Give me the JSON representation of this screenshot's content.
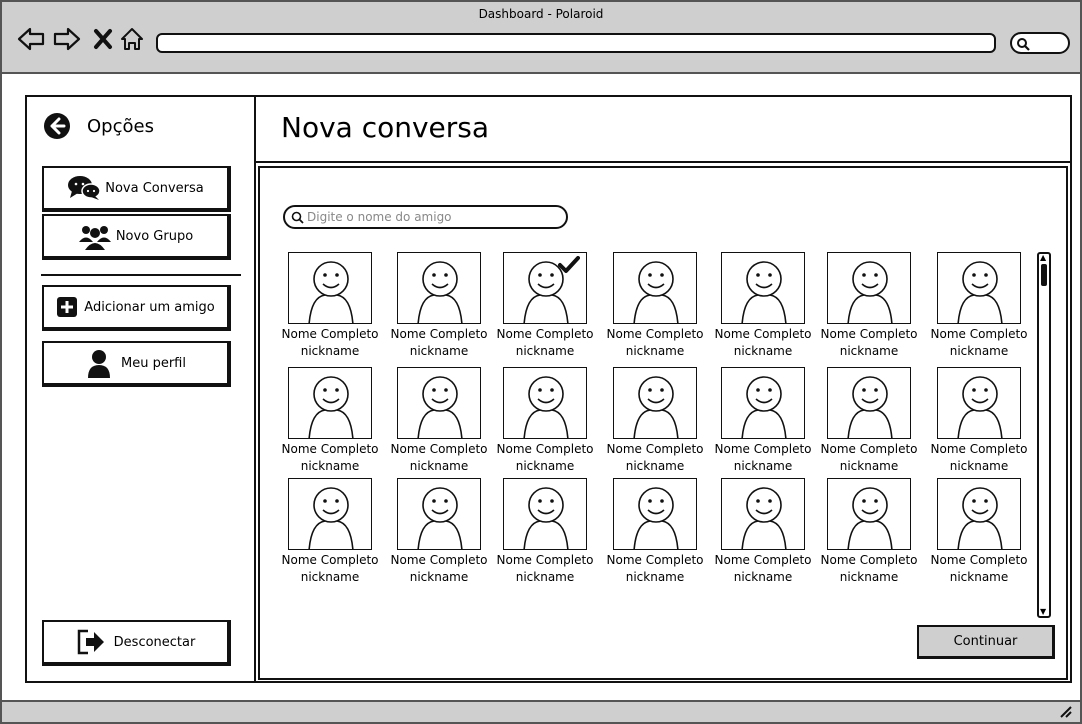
{
  "window": {
    "title": "Dashboard - Polaroid"
  },
  "sidebar": {
    "header": "Opções",
    "items": [
      {
        "label": "Nova Conversa",
        "icon": "chat-bubbles-icon"
      },
      {
        "label": "Novo Grupo",
        "icon": "group-icon"
      },
      {
        "label": "Adicionar um amigo",
        "icon": "plus-square-icon"
      },
      {
        "label": "Meu perfil",
        "icon": "user-icon"
      }
    ],
    "logout_label": "Desconectar"
  },
  "main": {
    "title": "Nova conversa",
    "search_placeholder": "Digite o nome do amigo",
    "friends": [
      {
        "name": "Nome Completo",
        "nickname": "nickname",
        "selected": false
      },
      {
        "name": "Nome Completo",
        "nickname": "nickname",
        "selected": false
      },
      {
        "name": "Nome Completo",
        "nickname": "nickname",
        "selected": true
      },
      {
        "name": "Nome Completo",
        "nickname": "nickname",
        "selected": false
      },
      {
        "name": "Nome Completo",
        "nickname": "nickname",
        "selected": false
      },
      {
        "name": "Nome Completo",
        "nickname": "nickname",
        "selected": false
      },
      {
        "name": "Nome Completo",
        "nickname": "nickname",
        "selected": false
      },
      {
        "name": "Nome Completo",
        "nickname": "nickname",
        "selected": false
      },
      {
        "name": "Nome Completo",
        "nickname": "nickname",
        "selected": false
      },
      {
        "name": "Nome Completo",
        "nickname": "nickname",
        "selected": false
      },
      {
        "name": "Nome Completo",
        "nickname": "nickname",
        "selected": false
      },
      {
        "name": "Nome Completo",
        "nickname": "nickname",
        "selected": false
      },
      {
        "name": "Nome Completo",
        "nickname": "nickname",
        "selected": false
      },
      {
        "name": "Nome Completo",
        "nickname": "nickname",
        "selected": false
      },
      {
        "name": "Nome Completo",
        "nickname": "nickname",
        "selected": false
      },
      {
        "name": "Nome Completo",
        "nickname": "nickname",
        "selected": false
      },
      {
        "name": "Nome Completo",
        "nickname": "nickname",
        "selected": false
      },
      {
        "name": "Nome Completo",
        "nickname": "nickname",
        "selected": false
      },
      {
        "name": "Nome Completo",
        "nickname": "nickname",
        "selected": false
      },
      {
        "name": "Nome Completo",
        "nickname": "nickname",
        "selected": false
      },
      {
        "name": "Nome Completo",
        "nickname": "nickname",
        "selected": false
      }
    ],
    "continue_label": "Continuar"
  },
  "colors": {
    "chrome": "#cfcfcf",
    "ink": "#111111",
    "button_bg": "#cfcfcf"
  }
}
